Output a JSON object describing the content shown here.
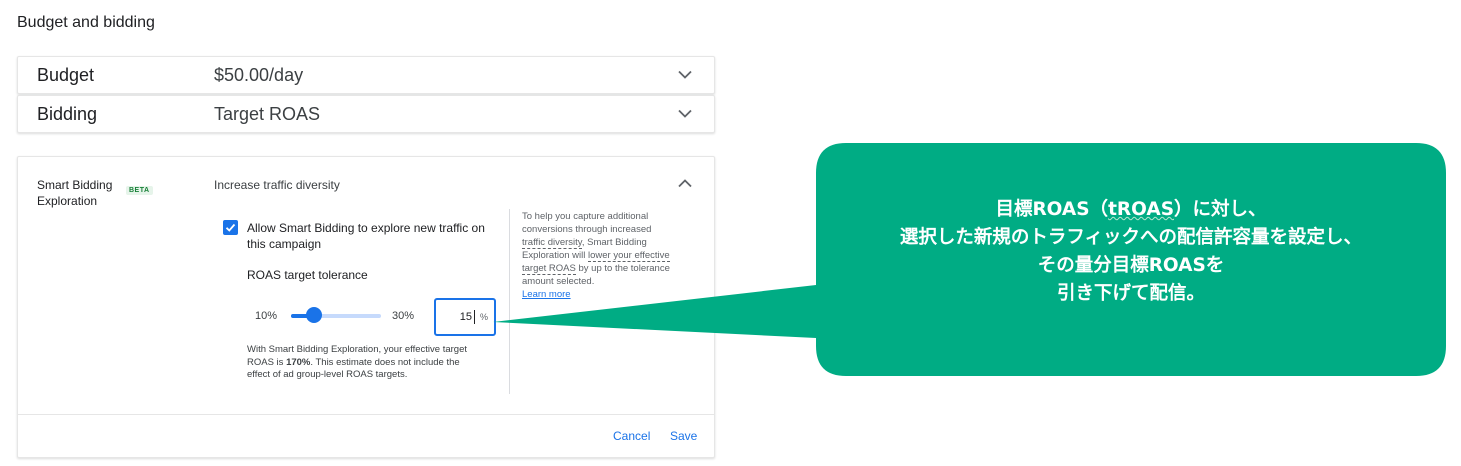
{
  "section_title": "Budget and bidding",
  "budget": {
    "label": "Budget",
    "value": "$50.00/day"
  },
  "bidding": {
    "label": "Bidding",
    "value": "Target ROAS"
  },
  "exploration": {
    "label": "Smart Bidding Exploration",
    "badge": "BETA",
    "summary": "Increase traffic diversity",
    "checkbox_checked": true,
    "checkbox_label": "Allow Smart Bidding to explore new traffic on this campaign",
    "tolerance_label": "ROAS target tolerance",
    "slider": {
      "min_label": "10%",
      "max_label": "30%",
      "min": 10,
      "max": 30,
      "value": 15
    },
    "input_value": "15",
    "input_unit": "%",
    "estimate_prefix": "With Smart Bidding Exploration, your effective target ROAS is ",
    "estimate_value": "170%",
    "estimate_suffix": ". This estimate does not include the effect of ad group-level ROAS targets.",
    "help_part1": "To help you capture additional conversions through increased ",
    "help_link1": "traffic diversity",
    "help_part2": ", Smart Bidding Exploration will ",
    "help_link2": "lower your effective target ROAS",
    "help_part3": " by up to the tolerance amount selected.",
    "learn_more": "Learn more",
    "cancel": "Cancel",
    "save": "Save"
  },
  "callout": {
    "color": "#00ac84",
    "line1_pre": "目標ROAS（",
    "line1_underlined": "tROAS",
    "line1_post": "）に対し、",
    "line2": "選択した新規のトラフィックへの配信許容量を設定し、",
    "line3": "その量分目標ROASを",
    "line4": "引き下げて配信。"
  },
  "colors": {
    "accent": "#1a73e8",
    "beta_text": "#188038",
    "beta_bg": "#e6f4ea"
  }
}
